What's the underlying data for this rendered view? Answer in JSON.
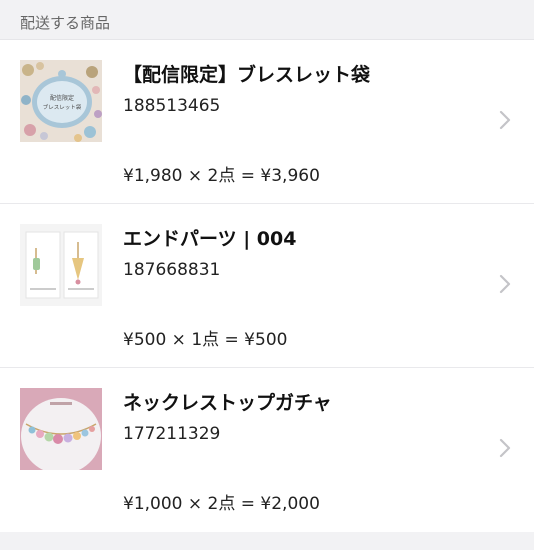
{
  "section": {
    "header": "配送する商品"
  },
  "items": [
    {
      "title": "【配信限定】ブレスレット袋",
      "sku": "188513465",
      "price_line": "¥1,980 × 2点 = ¥3,960",
      "thumb_caption_line1": "配信限定",
      "thumb_caption_line2": "ブレスレット袋"
    },
    {
      "title": "エンドパーツ | 004",
      "sku": "187668831",
      "price_line": "¥500 × 1点 = ¥500"
    },
    {
      "title": "ネックレストップガチャ",
      "sku": "177211329",
      "price_line": "¥1,000 × 2点 = ¥2,000"
    }
  ],
  "icons": {
    "chevron": "chevron-right-icon"
  },
  "colors": {
    "background": "#f2f2f4",
    "card": "#ffffff",
    "chevron": "#c4c4c8"
  }
}
